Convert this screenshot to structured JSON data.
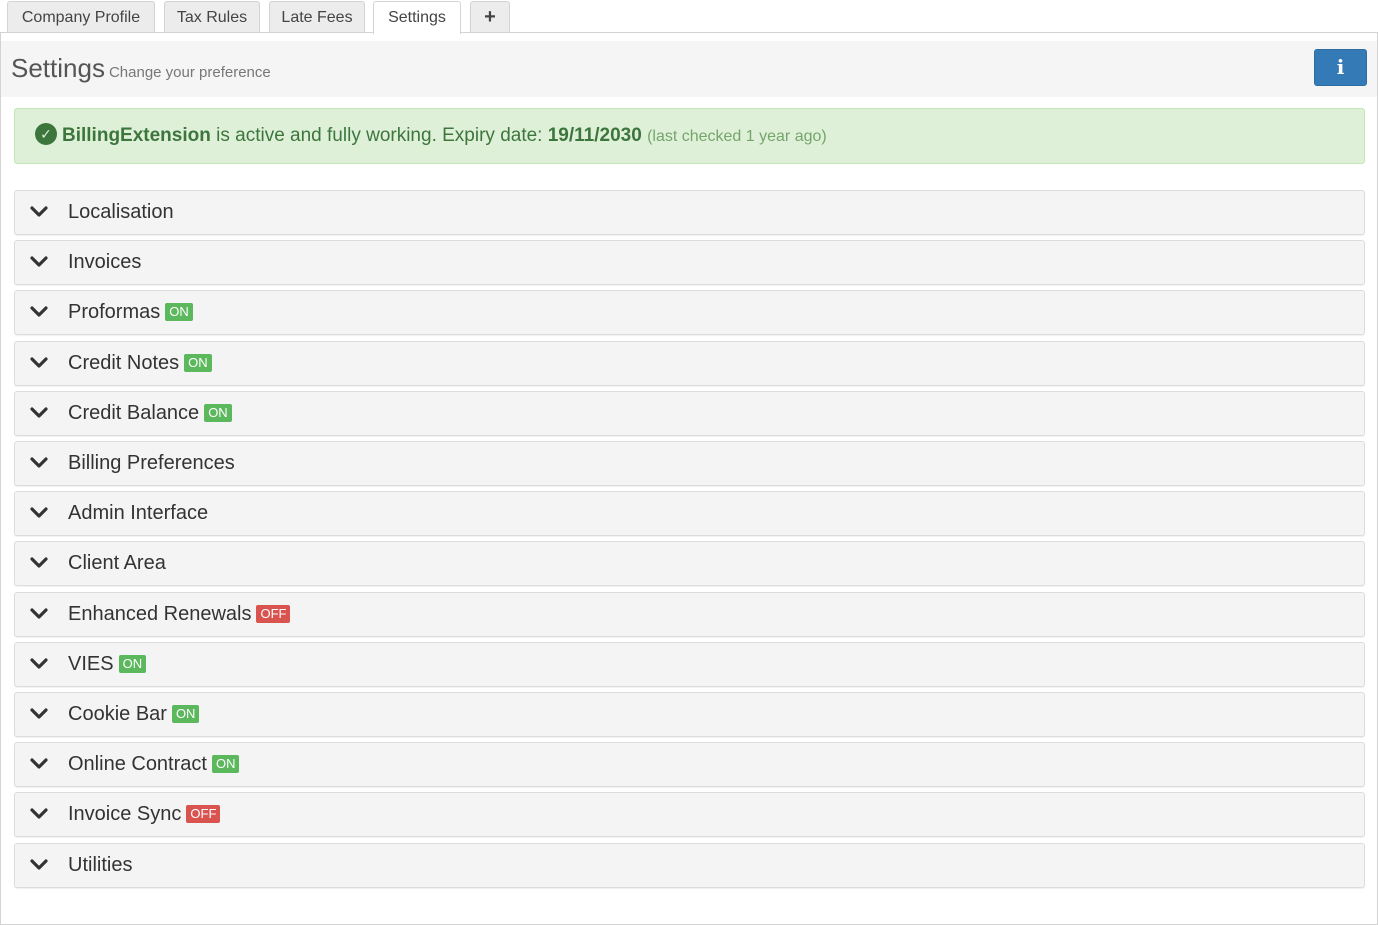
{
  "tabs": [
    {
      "label": "Company Profile"
    },
    {
      "label": "Tax Rules"
    },
    {
      "label": "Late Fees"
    },
    {
      "label": "Settings"
    },
    {
      "label": "+"
    }
  ],
  "active_tab": "Settings",
  "header": {
    "title": "Settings",
    "subtitle": "Change your preference",
    "info_icon": "i"
  },
  "alert": {
    "icon": "check-circle-icon",
    "product": "BillingExtension",
    "message": "is active and fully working. Expiry date:",
    "expiry": "19/11/2030",
    "checked": "(last checked 1 year ago)"
  },
  "sections": [
    {
      "label": "Localisation",
      "badge": ""
    },
    {
      "label": "Invoices",
      "badge": ""
    },
    {
      "label": "Proformas",
      "badge": "ON"
    },
    {
      "label": "Credit Notes",
      "badge": "ON"
    },
    {
      "label": "Credit Balance",
      "badge": "ON"
    },
    {
      "label": "Billing Preferences",
      "badge": ""
    },
    {
      "label": "Admin Interface",
      "badge": ""
    },
    {
      "label": "Client Area",
      "badge": ""
    },
    {
      "label": "Enhanced Renewals",
      "badge": "OFF"
    },
    {
      "label": "VIES",
      "badge": "ON"
    },
    {
      "label": "Cookie Bar",
      "badge": "ON"
    },
    {
      "label": "Online Contract",
      "badge": "ON"
    },
    {
      "label": "Invoice Sync",
      "badge": "OFF"
    },
    {
      "label": "Utilities",
      "badge": ""
    }
  ],
  "colors": {
    "on_badge": "#5cb85c",
    "off_badge": "#d9534f",
    "alert_bg": "#dff0d8",
    "info_button": "#337ab7"
  }
}
